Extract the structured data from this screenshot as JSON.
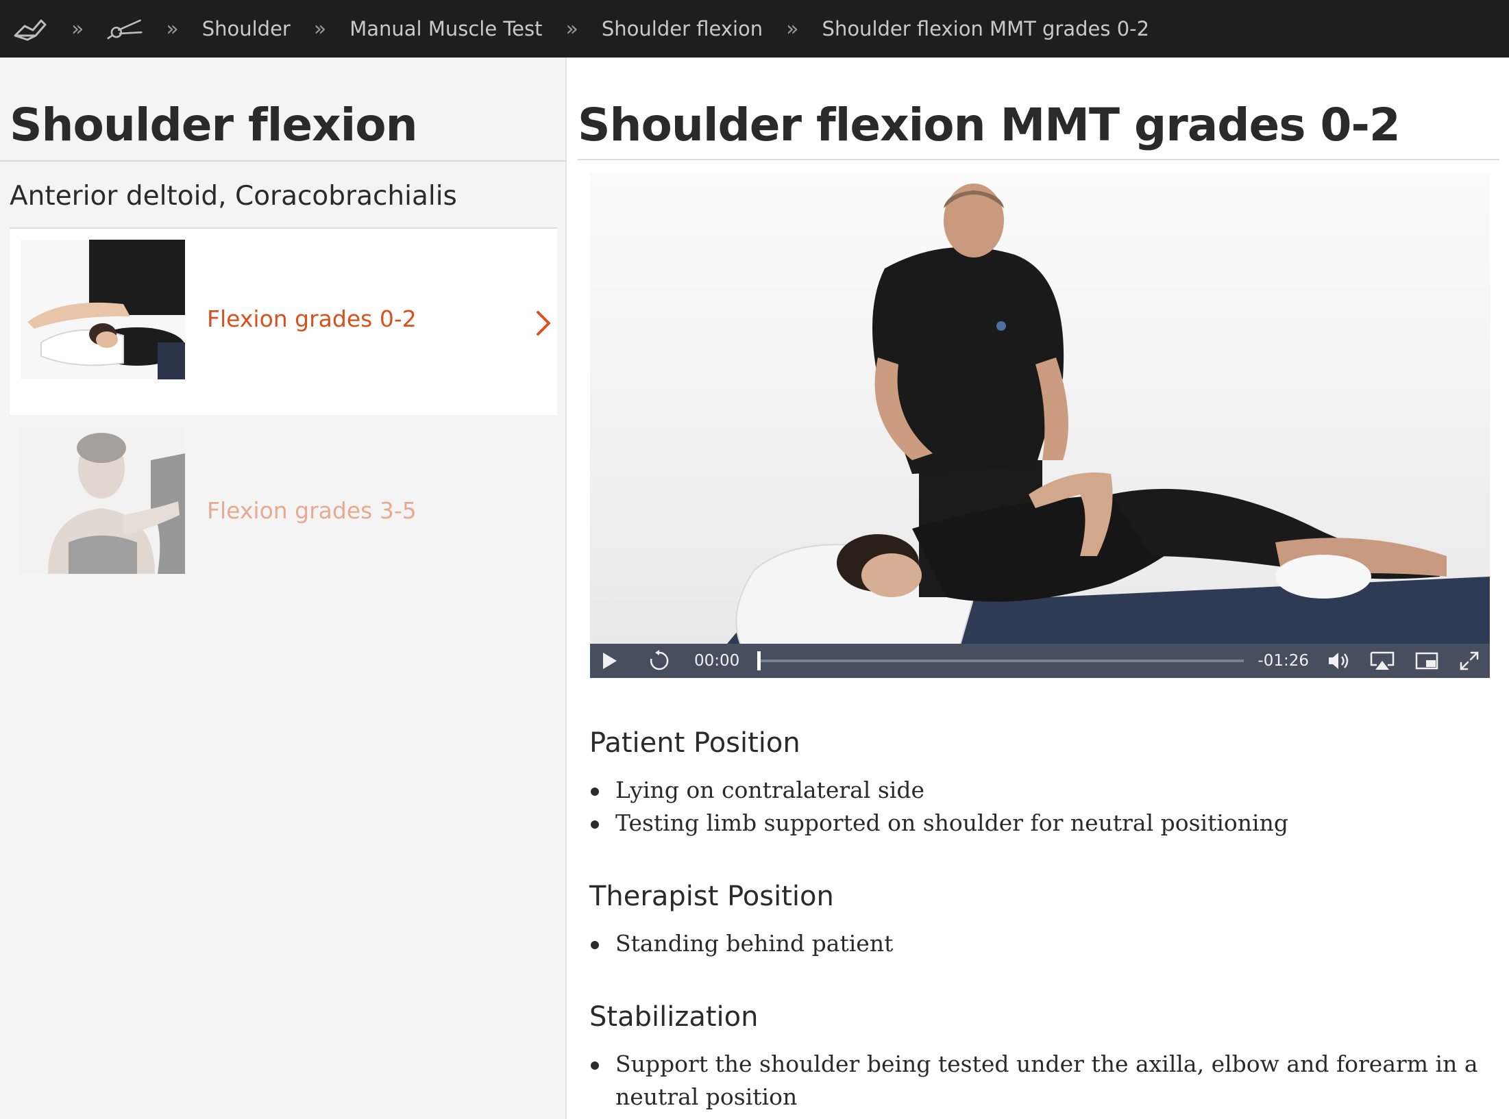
{
  "breadcrumb": {
    "home_icon": "home-icon",
    "category_icon": "goniometer-icon",
    "separator": "»",
    "items": [
      "Shoulder",
      "Manual Muscle Test",
      "Shoulder flexion",
      "Shoulder flexion MMT grades 0-2"
    ]
  },
  "sidebar": {
    "title": "Shoulder flexion",
    "muscles": "Anterior deltoid, Coracobrachialis",
    "items": [
      {
        "label": "Flexion grades 0-2",
        "active": true
      },
      {
        "label": "Flexion grades 3-5",
        "active": false
      }
    ]
  },
  "main": {
    "title": "Shoulder flexion MMT grades 0-2"
  },
  "video": {
    "current_time": "00:00",
    "remaining_time": "-01:26",
    "progress": 0,
    "skip_back_seconds": "30"
  },
  "sections": [
    {
      "heading": "Patient Position",
      "bullets": [
        "Lying on contralateral side",
        "Testing limb supported on shoulder for neutral positioning"
      ]
    },
    {
      "heading": "Therapist Position",
      "bullets": [
        "Standing behind patient"
      ]
    },
    {
      "heading": "Stabilization",
      "bullets": [
        "Support the shoulder being tested under the axilla, elbow and forearm in a neutral position"
      ]
    }
  ],
  "colors": {
    "accent": "#d9501c",
    "topbar": "#1e1e1e"
  }
}
